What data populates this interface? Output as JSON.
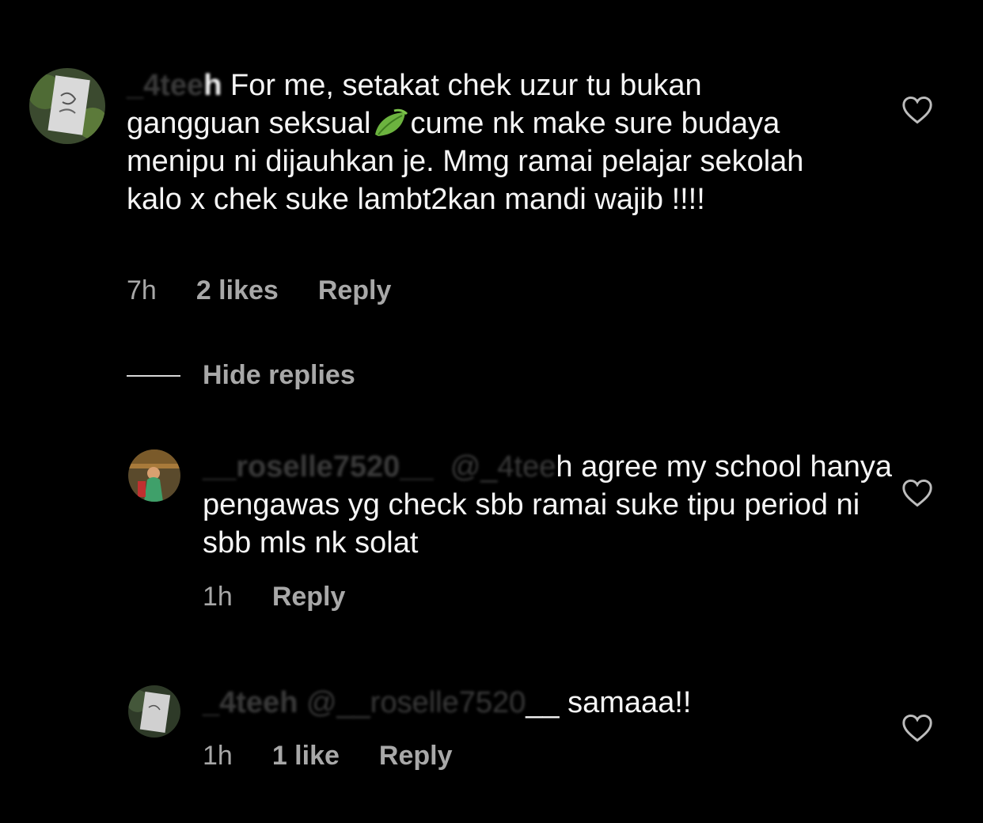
{
  "comments": [
    {
      "username_blur": "_4tee",
      "username_clear": "h",
      "text_before_emoji": " For me, setakat chek uzur tu bukan gangguan seksual",
      "emoji": "leaf-emoji",
      "text_after_emoji": "cume nk make sure budaya menipu ni dijauhkan je. Mmg ramai pelajar sekolah kalo x chek suke lambt2kan mandi wajib !!!!",
      "time": "7h",
      "likes": "2 likes",
      "reply_label": "Reply"
    }
  ],
  "hide_replies_label": "Hide replies",
  "replies": [
    {
      "username": "__roselle7520__",
      "mention_blur": "@_4tee",
      "mention_clear": "h",
      "text": " agree my school hanya pengawas yg check sbb ramai suke tipu period ni sbb mls nk solat",
      "time": "1h",
      "reply_label": "Reply"
    },
    {
      "username": "_4teeh",
      "mention_blur": "@__roselle7520",
      "mention_clear": "__",
      "text": " samaaa!!",
      "time": "1h",
      "likes": "1 like",
      "reply_label": "Reply"
    }
  ],
  "colors": {
    "background": "#000000",
    "text": "#f5f5f5",
    "secondary": "#a8a8a8"
  },
  "icons": {
    "like": "heart-outline-icon"
  }
}
